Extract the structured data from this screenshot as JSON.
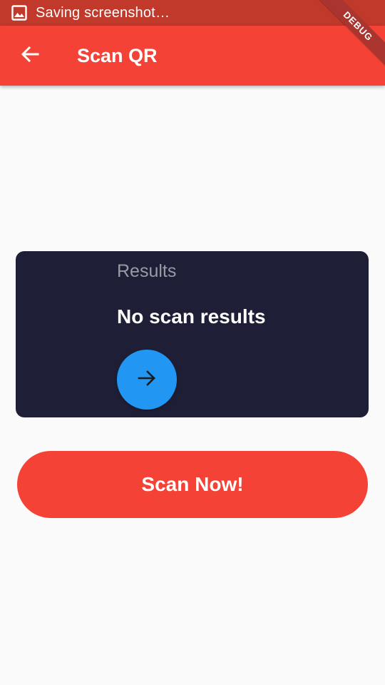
{
  "status_bar": {
    "text": "Saving screenshot…",
    "icon": "image-icon"
  },
  "app_bar": {
    "title": "Scan QR",
    "back_icon": "arrow-back-icon",
    "color": "#f44336"
  },
  "debug_banner": {
    "label": "DEBUG"
  },
  "results": {
    "label": "Results",
    "value": "No scan results",
    "action_icon": "arrow-forward-icon",
    "card_color": "#1e1f36",
    "action_color": "#2196f3"
  },
  "scan_button": {
    "label": "Scan Now!",
    "color": "#f44336"
  }
}
